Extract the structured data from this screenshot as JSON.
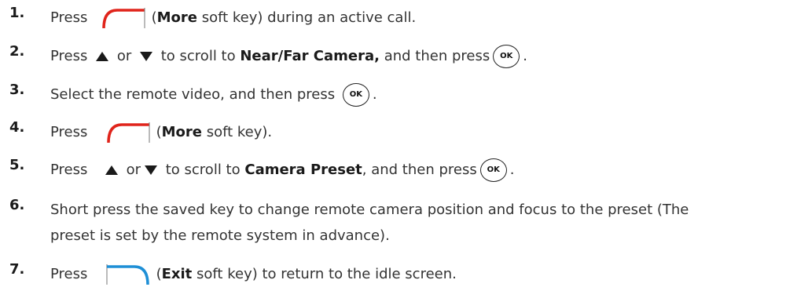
{
  "steps": [
    {
      "num": "1.",
      "parts": [
        "Press",
        "(",
        "More",
        " soft key) during an active call."
      ]
    },
    {
      "num": "2.",
      "parts": [
        "Press",
        "or",
        "to scroll to",
        "Near/Far Camera,",
        "and then press",
        "."
      ]
    },
    {
      "num": "3.",
      "parts": [
        "Select the remote video, and then press",
        "."
      ]
    },
    {
      "num": "4.",
      "parts": [
        "Press",
        "(",
        "More",
        " soft key)."
      ]
    },
    {
      "num": "5.",
      "parts": [
        "Press",
        "or",
        "to scroll to",
        "Camera Preset",
        ", and then press",
        "."
      ]
    },
    {
      "num": "6.",
      "line1": "Short press the saved key to change remote camera position and focus to the preset (The",
      "line2": "preset is set by the remote system in advance)."
    },
    {
      "num": "7.",
      "parts": [
        "Press",
        "(",
        "Exit",
        " soft key) to return to the idle screen."
      ]
    }
  ],
  "icons": {
    "ok_label": "OK",
    "more_key_color": "#e0241b",
    "exit_key_color": "#1e8fd6",
    "arrow_color": "#1a1a1a"
  }
}
